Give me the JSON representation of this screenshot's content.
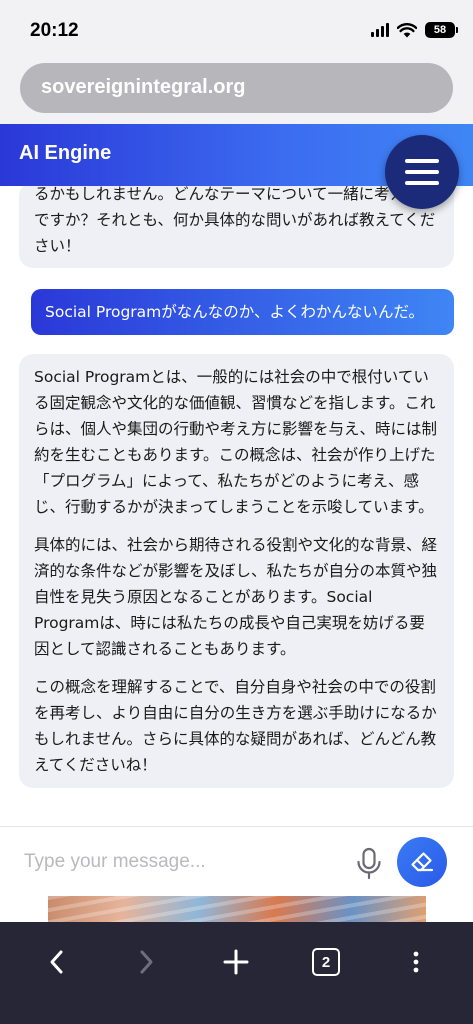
{
  "status_bar": {
    "time": "20:12",
    "battery": "58",
    "icons": [
      "cellular-signal-icon",
      "wifi-icon",
      "battery-icon"
    ]
  },
  "browser": {
    "url": "sovereignintegral.org",
    "tab_count": "2",
    "toolbar_icons": [
      "back-icon",
      "forward-icon",
      "new-tab-icon",
      "tab-switcher-icon",
      "more-icon"
    ]
  },
  "app": {
    "title": "AI Engine",
    "menu_icon": "hamburger-menu-icon"
  },
  "messages": [
    {
      "role": "assistant",
      "paragraphs": [
        "るかもしれません。どんなテーマについて一緒に考えたいですか？それとも、何か具体的な問いがあれば教えてください！"
      ]
    },
    {
      "role": "user",
      "text": "Social Programがなんなのか、よくわかんないんだ。"
    },
    {
      "role": "assistant",
      "paragraphs": [
        "Social Programとは、一般的には社会の中で根付いている固定観念や文化的な価値観、習慣などを指します。これらは、個人や集団の行動や考え方に影響を与え、時には制約を生むこともあります。この概念は、社会が作り上げた「プログラム」によって、私たちがどのように考え、感じ、行動するかが決まってしまうことを示唆しています。",
        "具体的には、社会から期待される役割や文化的な背景、経済的な条件などが影響を及ぼし、私たちが自分の本質や独自性を見失う原因となることがあります。Social Programは、時には私たちの成長や自己実現を妨げる要因として認識されることもあります。",
        "この概念を理解することで、自分自身や社会の中での役割を再考し、より自由に自分の生き方を選ぶ手助けになるかもしれません。さらに具体的な疑問があれば、どんどん教えてくださいね！"
      ]
    }
  ],
  "composer": {
    "placeholder": "Type your message...",
    "mic_icon": "microphone-icon",
    "send_icon": "eraser-icon"
  },
  "colors": {
    "accent_start": "#2a38d8",
    "accent_end": "#3f86f5",
    "menu_button": "#1c2a7a",
    "toolbar_bg": "#262637",
    "bubble_bg": "#eef0f5"
  }
}
